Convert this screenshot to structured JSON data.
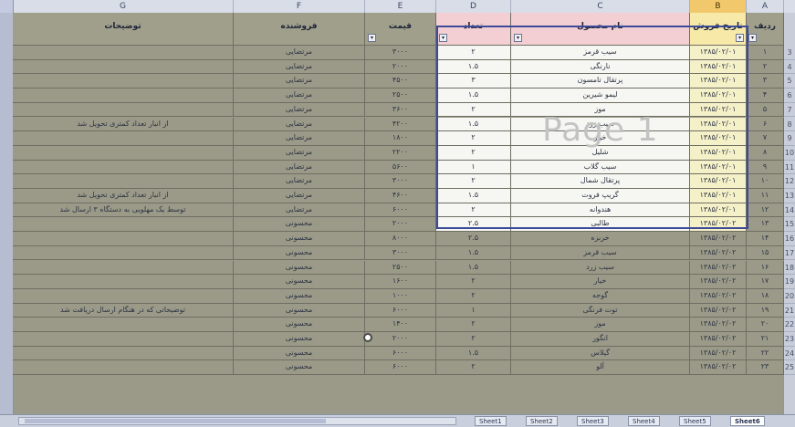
{
  "columns": [
    "G",
    "F",
    "E",
    "D",
    "C",
    "B",
    "A"
  ],
  "headers": {
    "notes": "توضیحات",
    "unit": "فروشنده",
    "price": "قیمت",
    "count": "تعداد",
    "product": "نام محصول",
    "date": "تاریخ فروش",
    "row": "ردیف"
  },
  "page_label": "Page 1",
  "rows": [
    {
      "rownum": "3",
      "notes": "",
      "seller": "مرتضایی",
      "price": "۳۰۰۰",
      "count": "۲",
      "product": "سیب قرمز",
      "date": "۱۳۸۵/۰۲/۰۱",
      "idx": "۱"
    },
    {
      "rownum": "4",
      "notes": "",
      "seller": "مرتضایی",
      "price": "۲۰۰۰",
      "count": "۱.۵",
      "product": "نارنگی",
      "date": "۱۳۸۵/۰۲/۰۱",
      "idx": "۲"
    },
    {
      "rownum": "5",
      "notes": "",
      "seller": "مرتضایی",
      "price": "۴۵۰۰",
      "count": "۳",
      "product": "پرتقال تامسون",
      "date": "۱۳۸۵/۰۲/۰۱",
      "idx": "۳"
    },
    {
      "rownum": "6",
      "notes": "",
      "seller": "مرتضایی",
      "price": "۲۵۰۰",
      "count": "۱.۵",
      "product": "لیمو شیرین",
      "date": "۱۳۸۵/۰۲/۰۱",
      "idx": "۴"
    },
    {
      "rownum": "7",
      "notes": "",
      "seller": "مرتضایی",
      "price": "۳۶۰۰",
      "count": "۲",
      "product": "موز",
      "date": "۱۳۸۵/۰۲/۰۱",
      "idx": "۵"
    },
    {
      "rownum": "8",
      "notes": "از انبار تعداد کمتری تحویل شد",
      "seller": "مرتضایی",
      "price": "۴۲۰۰",
      "count": "۱.۵",
      "product": "سیب زرد",
      "date": "۱۳۸۵/۰۲/۰۱",
      "idx": "۶"
    },
    {
      "rownum": "9",
      "notes": "",
      "seller": "مرتضایی",
      "price": "۱۸۰۰",
      "count": "۲",
      "product": "خیار",
      "date": "۱۳۸۵/۰۲/۰۱",
      "idx": "۷"
    },
    {
      "rownum": "10",
      "notes": "",
      "seller": "مرتضایی",
      "price": "۲۲۰۰",
      "count": "۲",
      "product": "شلیل",
      "date": "۱۳۸۵/۰۲/۰۱",
      "idx": "۸"
    },
    {
      "rownum": "11",
      "notes": "",
      "seller": "مرتضایی",
      "price": "۵۶۰۰",
      "count": "۱",
      "product": "سیب گلاب",
      "date": "۱۳۸۵/۰۲/۰۱",
      "idx": "۹"
    },
    {
      "rownum": "12",
      "notes": "",
      "seller": "مرتضایی",
      "price": "۳۰۰۰",
      "count": "۲",
      "product": "پرتقال شمال",
      "date": "۱۳۸۵/۰۲/۰۱",
      "idx": "۱۰"
    },
    {
      "rownum": "13",
      "notes": "از انبار تعداد کمتری تحویل شد",
      "seller": "مرتضایی",
      "price": "۴۶۰۰",
      "count": "۱.۵",
      "product": "گریپ فروت",
      "date": "۱۳۸۵/۰۲/۰۱",
      "idx": "۱۱"
    },
    {
      "rownum": "14",
      "notes": "توسط یک مهلویی به دستگاه ۳ ارسال شد",
      "seller": "مرتضایی",
      "price": "۶۰۰۰",
      "count": "۲",
      "product": "هندوانه",
      "date": "۱۳۸۵/۰۲/۰۱",
      "idx": "۱۲"
    },
    {
      "rownum": "15",
      "notes": "",
      "seller": "محسونی",
      "price": "۲۰۰۰",
      "count": "۲.۵",
      "product": "طالبی",
      "date": "۱۳۸۵/۰۲/۰۲",
      "idx": "۱۳"
    },
    {
      "rownum": "16",
      "notes": "",
      "seller": "محسونی",
      "price": "۸۰۰۰",
      "count": "۲.۵",
      "product": "خربزه",
      "date": "۱۳۸۵/۰۲/۰۲",
      "idx": "۱۴"
    },
    {
      "rownum": "17",
      "notes": "",
      "seller": "محسونی",
      "price": "۳۰۰۰",
      "count": "۱.۵",
      "product": "سیب قرمز",
      "date": "۱۳۸۵/۰۲/۰۲",
      "idx": "۱۵"
    },
    {
      "rownum": "18",
      "notes": "",
      "seller": "محسونی",
      "price": "۲۵۰۰",
      "count": "۱.۵",
      "product": "سیب زرد",
      "date": "۱۳۸۵/۰۲/۰۲",
      "idx": "۱۶"
    },
    {
      "rownum": "19",
      "notes": "",
      "seller": "محسونی",
      "price": "۱۶۰۰",
      "count": "۲",
      "product": "خیار",
      "date": "۱۳۸۵/۰۲/۰۲",
      "idx": "۱۷"
    },
    {
      "rownum": "20",
      "notes": "",
      "seller": "محسونی",
      "price": "۱۰۰۰",
      "count": "۲",
      "product": "گوجه",
      "date": "۱۳۸۵/۰۲/۰۲",
      "idx": "۱۸"
    },
    {
      "rownum": "21",
      "notes": "توضیحاتی که در هنگام ارسال دریافت شد",
      "seller": "محسونی",
      "price": "۶۰۰۰",
      "count": "۱",
      "product": "توت فرنگی",
      "date": "۱۳۸۵/۰۲/۰۲",
      "idx": "۱۹"
    },
    {
      "rownum": "22",
      "notes": "",
      "seller": "محسونی",
      "price": "۱۴۰۰",
      "count": "۲",
      "product": "موز",
      "date": "۱۳۸۵/۰۲/۰۲",
      "idx": "۲۰"
    },
    {
      "rownum": "23",
      "notes": "",
      "seller": "محسونی",
      "price": "۲۰۰۰",
      "count": "۲",
      "product": "انگور",
      "date": "۱۳۸۵/۰۲/۰۲",
      "idx": "۲۱"
    },
    {
      "rownum": "24",
      "notes": "",
      "seller": "محسونی",
      "price": "۶۰۰۰",
      "count": "۱.۵",
      "product": "گیلاس",
      "date": "۱۳۸۵/۰۲/۰۲",
      "idx": "۲۲"
    },
    {
      "rownum": "25",
      "notes": "",
      "seller": "محسونی",
      "price": "۶۰۰۰",
      "count": "۲",
      "product": "آلو",
      "date": "۱۳۸۵/۰۲/۰۲",
      "idx": "۲۳"
    }
  ],
  "sheet_tabs": [
    "Sheet1",
    "Sheet2",
    "Sheet3",
    "Sheet4",
    "Sheet5",
    "Sheet6"
  ]
}
